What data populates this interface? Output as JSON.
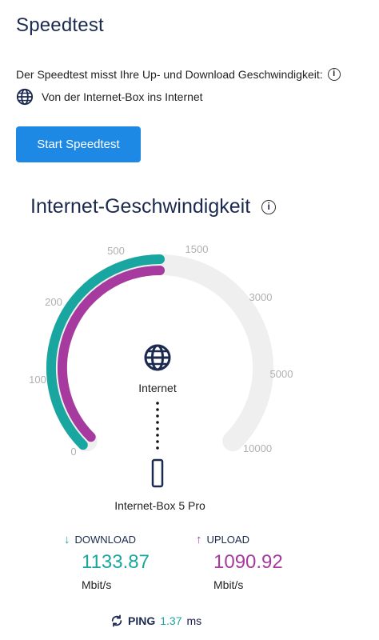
{
  "page": {
    "title": "Speedtest"
  },
  "intro": {
    "description": "Der Speedtest misst Ihre Up- und Download Geschwindigkeit:",
    "route": "Von der Internet-Box ins Internet"
  },
  "start_button": {
    "label": "Start Speedtest"
  },
  "section": {
    "title": "Internet-Geschwindigkeit"
  },
  "gauge": {
    "scale_labels": [
      "0",
      "100",
      "200",
      "500",
      "1500",
      "3000",
      "5000",
      "10000"
    ],
    "internet_label": "Internet",
    "device_label": "Internet-Box 5 Pro",
    "download_fill_fraction": 0.5,
    "upload_fill_fraction": 0.5
  },
  "download": {
    "label": "DOWNLOAD",
    "value": "1133.87",
    "unit": "Mbit/s"
  },
  "upload": {
    "label": "UPLOAD",
    "value": "1090.92",
    "unit": "Mbit/s"
  },
  "ping": {
    "label": "PING",
    "value": "1.37",
    "unit": "ms"
  },
  "colors": {
    "accent": "#1e88e5",
    "download": "#1aa6a0",
    "upload": "#a63a9e",
    "track": "#efefef",
    "navy": "#1b2a4e"
  }
}
